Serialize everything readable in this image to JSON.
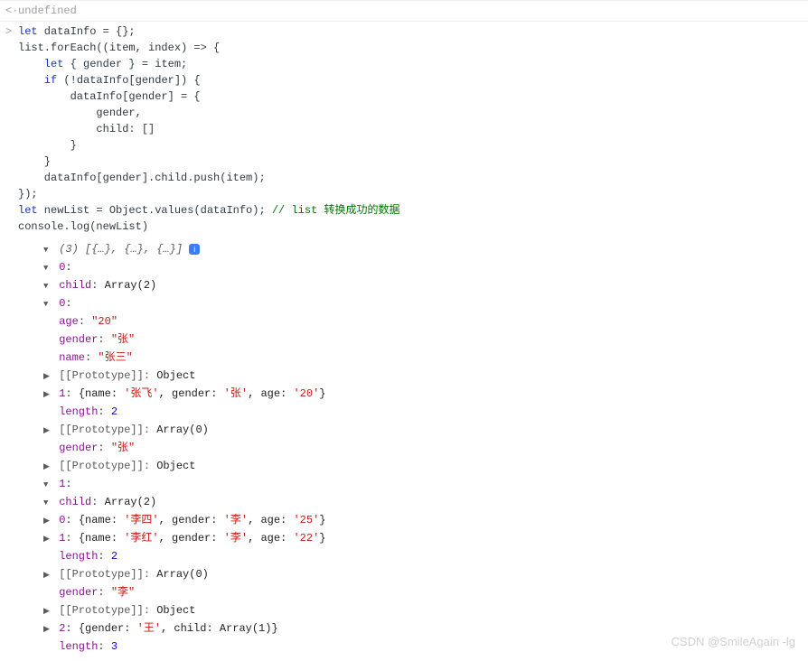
{
  "return_line": "undefined",
  "code": {
    "l1a": "let",
    "l1b": " dataInfo = {};",
    "l2a": "list.forEach((item, index) => {",
    "l3a": "    let",
    "l3b": " { gender } = item;",
    "l4a": "    if",
    "l4b": " (!dataInfo[gender]) {",
    "l5": "        dataInfo[gender] = {",
    "l6": "            gender,",
    "l7": "            child: []",
    "l8": "        }",
    "l9": "    }",
    "l10": "    dataInfo[gender].child.push(item);",
    "l11": "});",
    "l12a": "let",
    "l12b": " newList = Object.values(dataInfo); ",
    "l12c": "// list 转换成功的数据",
    "l13": "console.log(newList)"
  },
  "tree": {
    "root_summary": "(3) [{…}, {…}, {…}]",
    "idx0": "0",
    "child_label": "child",
    "array2": "Array(2)",
    "idx0_1": "0",
    "age_k": "age",
    "age_v0": "\"20\"",
    "gender_k": "gender",
    "gender_v0": "\"张\"",
    "name_k": "name",
    "name_v0": "\"张三\"",
    "proto_label": "[[Prototype]]",
    "object_label": "Object",
    "idx1": "1",
    "obj0_1_inline": "{name: '张飞', gender: '张', age: '20'}",
    "length_k": "length",
    "length_2": "2",
    "array0": "Array(0)",
    "gender_v_outer0": "\"张\"",
    "idx1_outer": "1",
    "obj1_0_inline": "{name: '李四', gender: '李', age: '25'}",
    "obj1_1_inline": "{name: '李红', gender: '李', age: '22'}",
    "gender_v_outer1": "\"李\"",
    "idx2": "2",
    "obj2_inline": "{gender: '王', child: Array(1)}",
    "length_3": "3"
  },
  "watermark": "CSDN @SmileAgain -lg"
}
